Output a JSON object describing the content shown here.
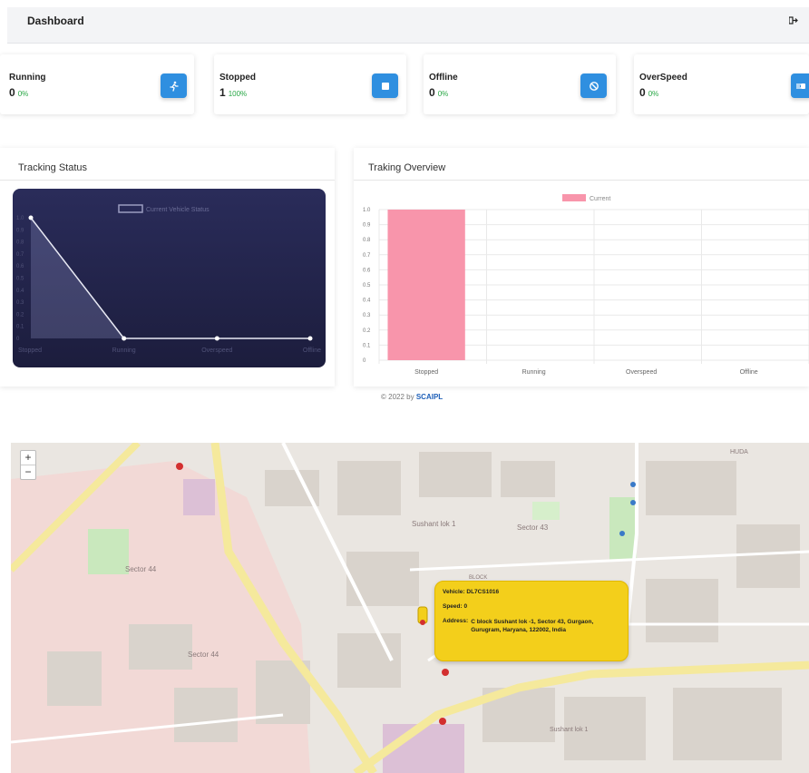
{
  "header": {
    "title": "Dashboard",
    "logout_icon": "sign-out-icon"
  },
  "stats": [
    {
      "label": "Running",
      "value": "0",
      "percent": "0%",
      "icon": "running-person-icon"
    },
    {
      "label": "Stopped",
      "value": "1",
      "percent": "100%",
      "icon": "stop-square-icon"
    },
    {
      "label": "Offline",
      "value": "0",
      "percent": "0%",
      "icon": "ban-icon"
    },
    {
      "label": "OverSpeed",
      "value": "0",
      "percent": "0%",
      "icon": "fast-vehicle-icon"
    }
  ],
  "tracking_status": {
    "title": "Tracking Status",
    "chart_data": {
      "type": "line",
      "legend": [
        "Current Vehicle Status"
      ],
      "categories": [
        "Stopped",
        "Running",
        "Overspeed",
        "Offline"
      ],
      "series": [
        {
          "name": "Current Vehicle Status",
          "values": [
            1,
            0,
            0,
            0
          ]
        }
      ],
      "ylim": [
        0,
        1
      ],
      "yticks": [
        "0",
        "0.1",
        "0.2",
        "0.3",
        "0.4",
        "0.5",
        "0.6",
        "0.7",
        "0.8",
        "0.9",
        "1.0"
      ]
    }
  },
  "tracking_overview": {
    "title": "Traking Overview",
    "chart_data": {
      "type": "bar",
      "legend": [
        "Current"
      ],
      "categories": [
        "Stopped",
        "Running",
        "Overspeed",
        "Offline"
      ],
      "series": [
        {
          "name": "Current",
          "values": [
            1,
            0,
            0,
            0
          ]
        }
      ],
      "ylim": [
        0,
        1
      ],
      "yticks": [
        "0",
        "0.1",
        "0.2",
        "0.3",
        "0.4",
        "0.5",
        "0.6",
        "0.7",
        "0.8",
        "0.9",
        "1.0"
      ],
      "color": "#f895ab"
    }
  },
  "footer": {
    "text": "© 2022 by",
    "brand": "SCAIPL"
  },
  "map": {
    "zoom_in": "+",
    "zoom_out": "−",
    "popup": {
      "vehicle_label": "Vehicle:",
      "vehicle_value": "DL7CS1016",
      "speed_label": "Speed:",
      "speed_value": "0",
      "address_label": "Address:",
      "address_value": "C block Sushant lok -1, Sector 43, Gurgaon, Gurugram, Haryana, 122002, India"
    },
    "labels": [
      "Sector 44",
      "Sector 44",
      "Sushant lok 1",
      "Sector 43",
      "HUDA",
      "Sushant lok 1",
      "BLOCK"
    ]
  },
  "colors": {
    "accent": "#2f8fe0",
    "popup": "#f3cf1b",
    "bar": "#f895ab",
    "success": "#28a745"
  }
}
